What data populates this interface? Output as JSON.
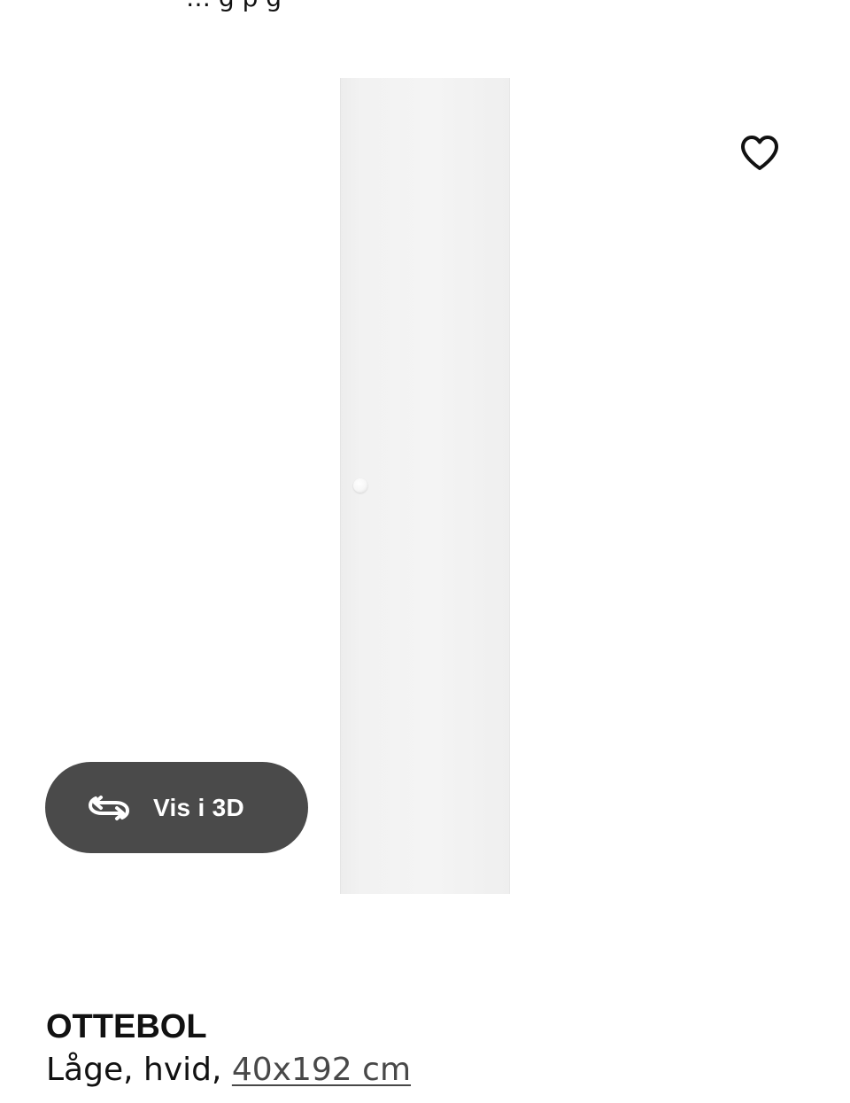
{
  "header": {
    "partial_text": "… g   p       g"
  },
  "product": {
    "name": "OTTEBOL",
    "description": "Låge, hvid, ",
    "size_link": "40x192 cm"
  },
  "actions": {
    "view_3d_label": "Vis i 3D",
    "view_3d_icon": "rotate-3d-icon",
    "favourite_icon": "heart-outline-icon"
  },
  "colors": {
    "view_3d_bg": "#4a4a4a",
    "view_3d_text": "#ffffff",
    "text": "#111111",
    "link": "#484848"
  }
}
